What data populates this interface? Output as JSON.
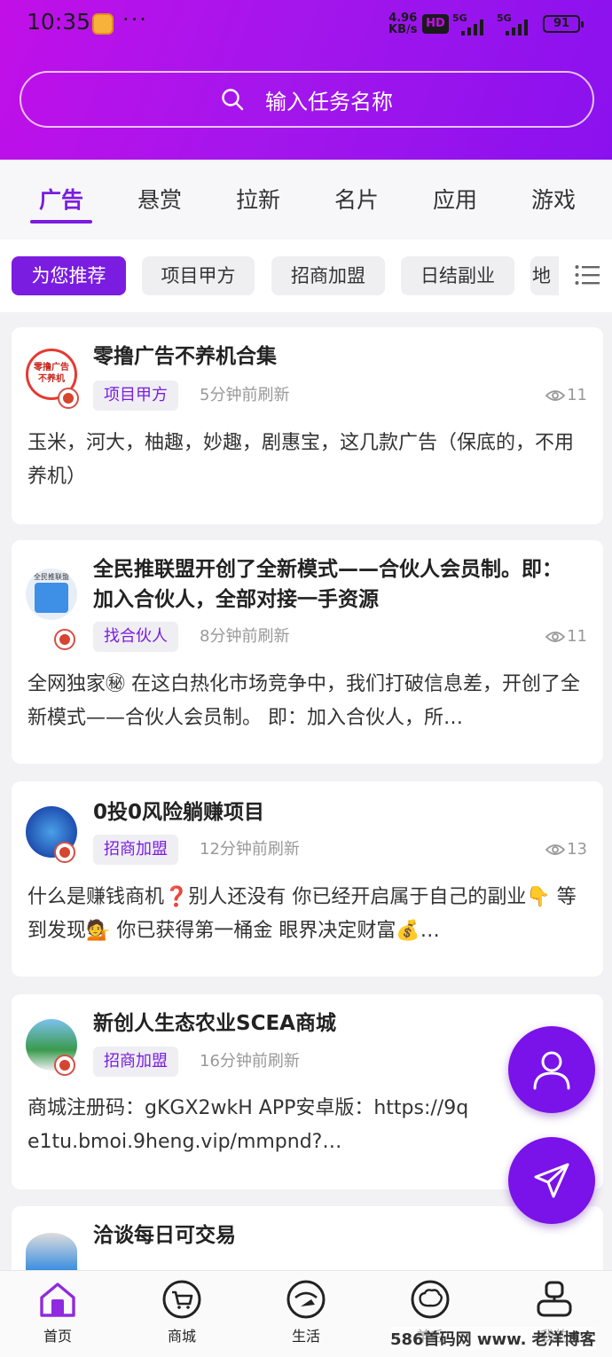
{
  "status_bar": {
    "time": "10:35",
    "dots": "···",
    "net_speed_value": "4.96",
    "net_speed_unit": "KB/s",
    "hd_label": "HD",
    "sim1_label": "5G",
    "sim2_label": "5G",
    "battery": "91"
  },
  "search": {
    "placeholder": "输入任务名称"
  },
  "category_tabs": [
    {
      "label": "广告",
      "active": true
    },
    {
      "label": "悬赏"
    },
    {
      "label": "拉新"
    },
    {
      "label": "名片"
    },
    {
      "label": "应用"
    },
    {
      "label": "游戏"
    }
  ],
  "filter_chips": [
    {
      "label": "为您推荐",
      "active": true
    },
    {
      "label": "项目甲方"
    },
    {
      "label": "招商加盟"
    },
    {
      "label": "日结副业"
    },
    {
      "label": "地"
    }
  ],
  "posts": [
    {
      "title": "零撸广告不养机合集",
      "avatar_text": "零撸广告 不养机",
      "tag": "项目甲方",
      "time": "5分钟前刷新",
      "views": "11",
      "body": "玉米，河大，柚趣，妙趣，剧惠宝，这几款广告（保底的，不用养机）"
    },
    {
      "title": "全民推联盟开创了全新模式——合伙人会员制。即：加入合伙人，全部对接一手资源",
      "avatar_text": "全民推联盟",
      "tag": "找合伙人",
      "time": "8分钟前刷新",
      "views": "11",
      "body": "全网独家㊙ 在这白热化市场竞争中，我们打破信息差，开创了全新模式——合伙人会员制。 即：加入合伙人，所…"
    },
    {
      "title": "0投0风险躺赚项目",
      "tag": "招商加盟",
      "time": "12分钟前刷新",
      "views": "13",
      "body": "什么是赚钱商机❓别人还没有 你已经开启属于自己的副业👇 等到发现💁 你已获得第一桶金 眼界决定财富💰…"
    },
    {
      "title": "新创人生态农业SCEA商城",
      "tag": "招商加盟",
      "time": "16分钟前刷新",
      "views": "",
      "body": "商城注册码：gKGX2wkH APP安卓版：https://9qe1tu.bmoi.9heng.vip/mmpnd?…"
    },
    {
      "title": "洽谈每日可交易"
    }
  ],
  "bottom_nav": [
    {
      "label": "首页",
      "icon": "home-icon",
      "active": true
    },
    {
      "label": "商城",
      "icon": "cart-icon"
    },
    {
      "label": "生活",
      "icon": "life-icon"
    },
    {
      "label": "羊毛",
      "icon": "sheep-icon"
    },
    {
      "label": "我的",
      "icon": "profile-icon"
    }
  ],
  "watermark": "586首码网 www.  老洋博客",
  "colors": {
    "accent": "#7a1de0",
    "header_gradient_start": "#c20fe8",
    "header_gradient_end": "#8a11ee"
  }
}
